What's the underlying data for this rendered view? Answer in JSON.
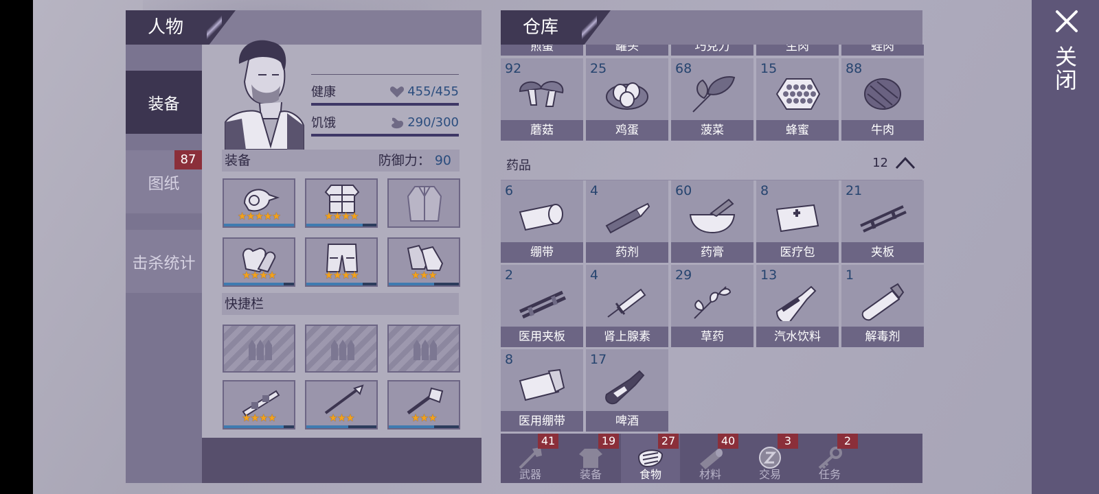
{
  "close": {
    "label": "关闭"
  },
  "character_panel": {
    "title": "人物",
    "side_tabs": [
      {
        "label": "装备",
        "active": true
      },
      {
        "label": "图纸",
        "badge": "87"
      },
      {
        "label": "击杀统计"
      }
    ],
    "stats": {
      "health": {
        "label": "健康",
        "value": "455/455",
        "icon": "heart-icon"
      },
      "hunger": {
        "label": "饥饿",
        "value": "290/300",
        "icon": "stomach-icon"
      }
    },
    "equipment": {
      "label": "装备",
      "defense_label": "防御力：",
      "defense_value": "90",
      "slots": [
        {
          "name": "helmet",
          "icon": "helmet-icon",
          "stars": "★★★★★",
          "durability": 1.0
        },
        {
          "name": "armor",
          "icon": "armor-icon",
          "stars": "★★★★",
          "durability": 0.8
        },
        {
          "name": "jacket",
          "icon": "jacket-icon",
          "stars": "",
          "durability": 0
        },
        {
          "name": "gloves",
          "icon": "gloves-icon",
          "stars": "★★★★",
          "durability": 0.85
        },
        {
          "name": "pants",
          "icon": "pants-icon",
          "stars": "★★★★",
          "durability": 0.8
        },
        {
          "name": "boots",
          "icon": "boots-icon",
          "stars": "★★★",
          "durability": 0.65
        }
      ]
    },
    "quickbar": {
      "label": "快捷栏",
      "empty_slots": 3,
      "weapons": [
        {
          "icon": "crossbow-icon",
          "stars": "★★★★",
          "durability": 0.85
        },
        {
          "icon": "spear-icon",
          "stars": "★★★",
          "durability": 0.6
        },
        {
          "icon": "flail-icon",
          "stars": "★★★",
          "durability": 0.65
        }
      ]
    }
  },
  "storage_panel": {
    "title": "仓库",
    "partial_row": [
      "煎蛋",
      "罐头",
      "巧克力",
      "生肉",
      "蛙肉"
    ],
    "food_row": [
      {
        "count": "92",
        "name": "蘑菇",
        "icon": "mushroom-icon"
      },
      {
        "count": "25",
        "name": "鸡蛋",
        "icon": "eggs-icon"
      },
      {
        "count": "68",
        "name": "菠菜",
        "icon": "spinach-icon"
      },
      {
        "count": "15",
        "name": "蜂蜜",
        "icon": "honeycomb-icon"
      },
      {
        "count": "88",
        "name": "牛肉",
        "icon": "beef-icon"
      }
    ],
    "medicine": {
      "label": "药品",
      "count": "12",
      "items": [
        {
          "count": "6",
          "name": "绷带",
          "icon": "bandage-icon"
        },
        {
          "count": "4",
          "name": "药剂",
          "icon": "syringe-icon"
        },
        {
          "count": "60",
          "name": "药膏",
          "icon": "ointment-icon"
        },
        {
          "count": "8",
          "name": "医疗包",
          "icon": "medkit-icon"
        },
        {
          "count": "21",
          "name": "夹板",
          "icon": "splint-icon"
        },
        {
          "count": "2",
          "name": "医用夹板",
          "icon": "medical-splint-icon"
        },
        {
          "count": "4",
          "name": "肾上腺素",
          "icon": "adrenaline-icon"
        },
        {
          "count": "29",
          "name": "草药",
          "icon": "herb-icon"
        },
        {
          "count": "13",
          "name": "汽水饮料",
          "icon": "soda-icon"
        },
        {
          "count": "1",
          "name": "解毒剂",
          "icon": "antidote-icon"
        },
        {
          "count": "8",
          "name": "医用绷带",
          "icon": "medical-bandage-icon"
        },
        {
          "count": "17",
          "name": "啤酒",
          "icon": "beer-icon"
        }
      ]
    },
    "bottom_tabs": [
      {
        "label": "武器",
        "badge": "41",
        "icon": "axe-icon"
      },
      {
        "label": "装备",
        "badge": "19",
        "icon": "shirt-icon"
      },
      {
        "label": "食物",
        "badge": "27",
        "icon": "food-icon",
        "active": true
      },
      {
        "label": "材料",
        "badge": "40",
        "icon": "log-icon"
      },
      {
        "label": "交易",
        "badge": "3",
        "icon": "coin-icon"
      },
      {
        "label": "任务",
        "badge": "2",
        "icon": "key-icon"
      }
    ]
  }
}
